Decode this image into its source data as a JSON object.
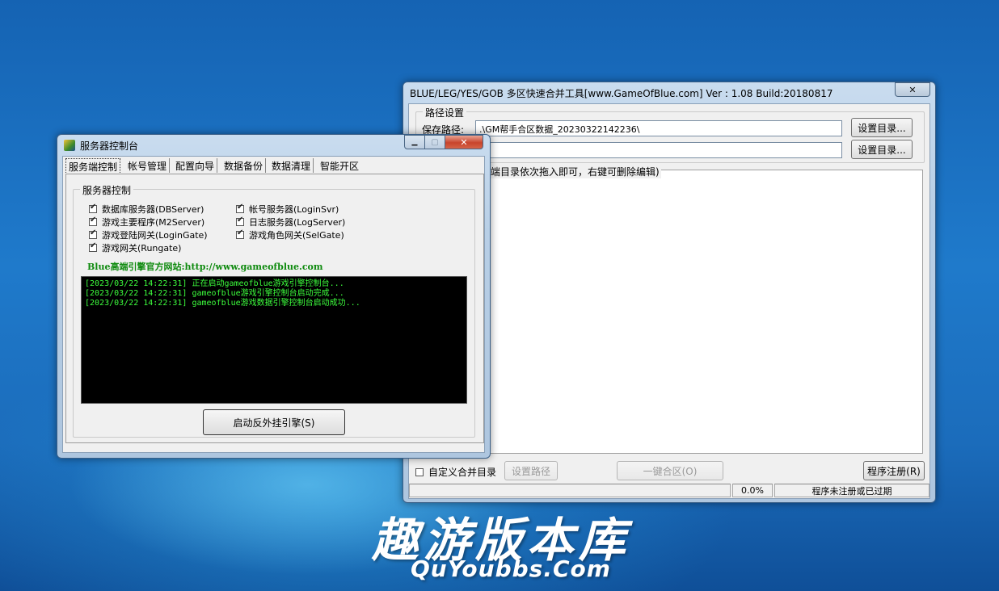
{
  "merge_window": {
    "title": "BLUE/LEG/YES/GOB 多区快速合并工具[www.GameOfBlue.com] Ver : 1.08 Build:20180817",
    "close_glyph": "✕",
    "path_group_label": "路径设置",
    "save_path_label": "保存路径:",
    "save_path_value": ".\\GM帮手合区数据_20230322142236\\",
    "second_path_value": "",
    "set_dir_button_1": "设置目录...",
    "set_dir_button_2": "设置目录...",
    "list_hint": "端目录依次拖入即可，右键可删除编辑)",
    "custom_merge_label": "自定义合并目录",
    "set_path_button": "设置路径",
    "one_click_merge_button": "一键合区(O)",
    "register_button": "程序注册(R)",
    "progress_percent": "0.0%",
    "status_text": "程序未注册或已过期"
  },
  "server_window": {
    "title": "服务器控制台",
    "tabs": [
      "服务端控制",
      "帐号管理",
      "配置向导",
      "数据备份",
      "数据清理",
      "智能开区"
    ],
    "group_label": "服务器控制",
    "checkboxes": [
      {
        "label": "数据库服务器(DBServer)",
        "checked": true
      },
      {
        "label": "游戏主要程序(M2Server)",
        "checked": true
      },
      {
        "label": "游戏登陆网关(LoginGate)",
        "checked": true
      },
      {
        "label": "游戏网关(Rungate)",
        "checked": true
      },
      {
        "label": "帐号服务器(LoginSvr)",
        "checked": true
      },
      {
        "label": "日志服务器(LogServer)",
        "checked": true
      },
      {
        "label": "游戏角色网关(SelGate)",
        "checked": true
      }
    ],
    "website_text": "Blue高端引擎官方网站:http://www.gameofblue.com",
    "log_lines": [
      "[2023/03/22 14:22:31] 正在启动gameofblue游戏引擎控制台...",
      "[2023/03/22 14:22:31] gameofblue游戏引擎控制台启动完成...",
      "[2023/03/22 14:22:31] gameofblue游戏数据引擎控制台启动成功..."
    ],
    "start_button": "启动反外挂引擎(S)",
    "minimize_glyph": "▁",
    "maximize_glyph": "▢",
    "close_glyph": "✕"
  },
  "watermark": {
    "chinese": "趣游版本库",
    "english": "QuYoubbs.Com"
  }
}
